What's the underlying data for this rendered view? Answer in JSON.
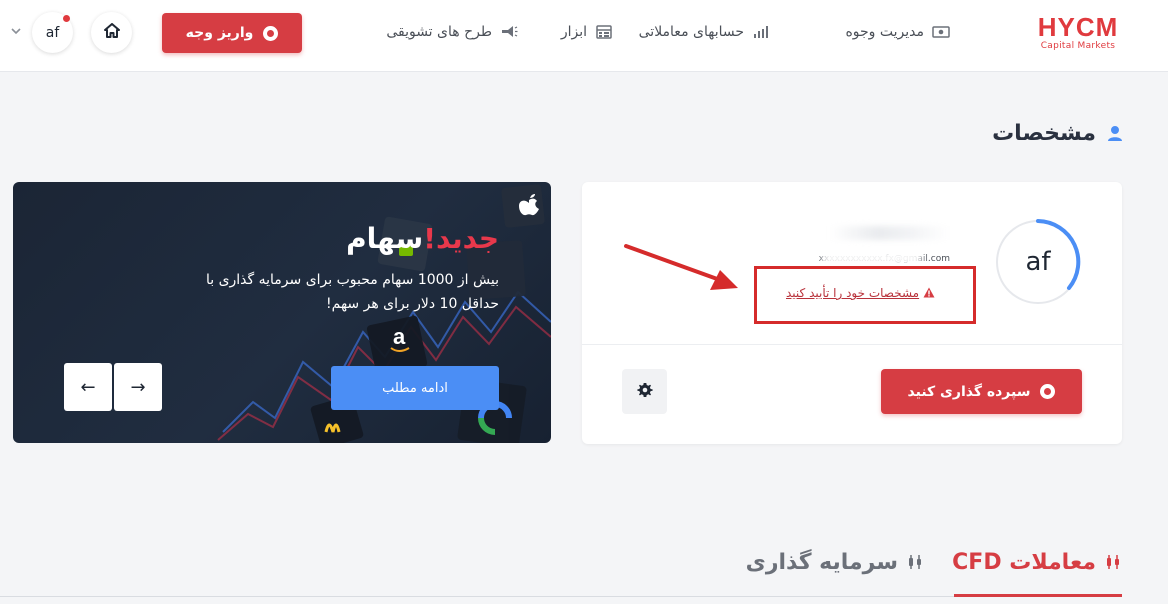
{
  "logo": {
    "brand": "HYCM",
    "sub": "Capital Markets"
  },
  "nav": [
    {
      "label": "مدیریت وجوه",
      "icon": "money-icon"
    },
    {
      "label": "حسابهای معاملاتی",
      "icon": "bar-chart-icon"
    },
    {
      "label": "ابزار",
      "icon": "calculator-icon"
    },
    {
      "label": "طرح های تشویقی",
      "icon": "megaphone-icon"
    }
  ],
  "header": {
    "deposit_label": "واریز وجه",
    "user_initials": "af"
  },
  "page": {
    "title": "مشخصات"
  },
  "profile": {
    "avatar_initials": "af",
    "email": "xxxxxxxxxxxx.fx@gmail.com",
    "verify_link": "مشخصات خود را تأیید کنید",
    "invest_label": "سپرده گذاری کنید"
  },
  "promo": {
    "title_red": "جدید!",
    "title_white": "سهام",
    "text": "بیش از 1000 سهام محبوب برای سرمایه گذاری با حداقل 10 دلار برای هر سهم!",
    "cta": "ادامه مطلب",
    "prev": "←",
    "next": "→"
  },
  "tabs": [
    {
      "label": "معاملات CFD",
      "active": true
    },
    {
      "label": "سرمایه گذاری",
      "active": false
    }
  ],
  "colors": {
    "brand_red": "#d63d43",
    "accent_blue": "#4b8ef5",
    "annotation_red": "#d52b2b"
  }
}
